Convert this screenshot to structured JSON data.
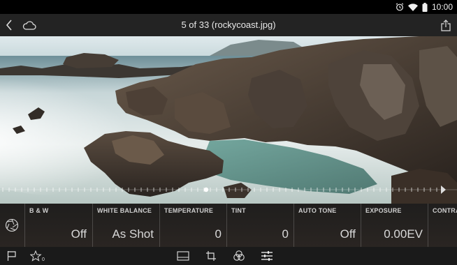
{
  "status_bar": {
    "time": "10:00"
  },
  "header": {
    "title": "5 of 33 (rockycoast.jpg)"
  },
  "colors": {
    "background": "#1b1b1b",
    "bar": "#232323",
    "text": "#e6e6e6"
  },
  "adjustments": [
    {
      "label": "B & W",
      "value": "Off"
    },
    {
      "label": "WHITE BALANCE",
      "value": "As Shot"
    },
    {
      "label": "TEMPERATURE",
      "value": "0"
    },
    {
      "label": "TINT",
      "value": "0"
    },
    {
      "label": "AUTO TONE",
      "value": "Off"
    },
    {
      "label": "EXPOSURE",
      "value": "0.00EV"
    },
    {
      "label": "CONTRAST",
      "value": ""
    }
  ],
  "icons": {
    "back": "back-arrow-icon",
    "cloud": "cloud-icon",
    "share": "share-icon",
    "presets": "aperture-icon",
    "flag": "flag-icon",
    "rating": "star-rating-icon",
    "crop_view": "filmstrip-icon",
    "crop": "crop-icon",
    "presets_tool": "presets-icon",
    "adjust": "adjust-sliders-icon"
  },
  "rating": {
    "stars": "0"
  }
}
